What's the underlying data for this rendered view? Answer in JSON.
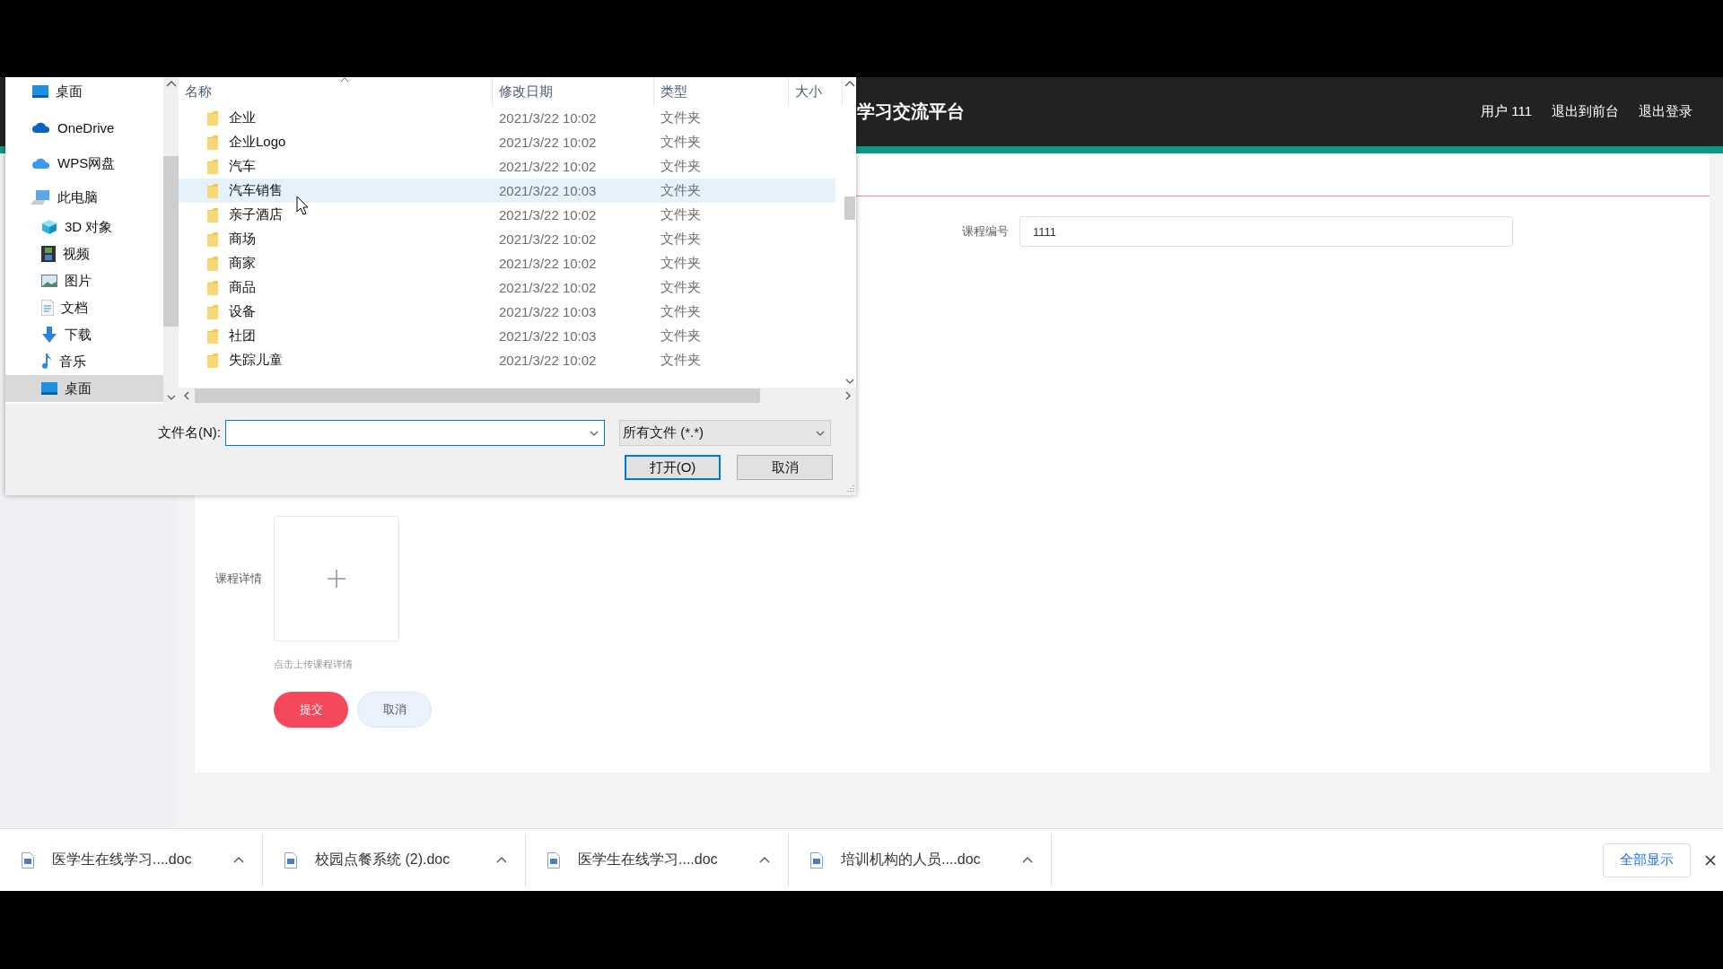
{
  "dialog": {
    "nav": [
      {
        "label": "桌面",
        "kind": "desktop",
        "selected": false
      },
      {
        "label": "OneDrive",
        "kind": "cloud",
        "selected": false
      },
      {
        "label": "WPS网盘",
        "kind": "cloud-light",
        "selected": false
      },
      {
        "label": "此电脑",
        "kind": "pc",
        "selected": false,
        "children": [
          {
            "label": "3D 对象",
            "kind": "cube",
            "selected": false
          },
          {
            "label": "视频",
            "kind": "film",
            "selected": false
          },
          {
            "label": "图片",
            "kind": "image",
            "selected": false
          },
          {
            "label": "文档",
            "kind": "document",
            "selected": false
          },
          {
            "label": "下载",
            "kind": "download",
            "selected": false
          },
          {
            "label": "音乐",
            "kind": "music",
            "selected": false
          },
          {
            "label": "桌面",
            "kind": "desktop",
            "selected": true
          }
        ]
      }
    ],
    "columns": [
      "名称",
      "修改日期",
      "类型",
      "大小"
    ],
    "rows": [
      {
        "name": "企业",
        "date": "2021/3/22 10:02",
        "type": "文件夹",
        "selected": false
      },
      {
        "name": "企业Logo",
        "date": "2021/3/22 10:02",
        "type": "文件夹",
        "selected": false
      },
      {
        "name": "汽车",
        "date": "2021/3/22 10:02",
        "type": "文件夹",
        "selected": false
      },
      {
        "name": "汽车销售",
        "date": "2021/3/22 10:03",
        "type": "文件夹",
        "selected": true
      },
      {
        "name": "亲子酒店",
        "date": "2021/3/22 10:02",
        "type": "文件夹",
        "selected": false
      },
      {
        "name": "商场",
        "date": "2021/3/22 10:02",
        "type": "文件夹",
        "selected": false
      },
      {
        "name": "商家",
        "date": "2021/3/22 10:02",
        "type": "文件夹",
        "selected": false
      },
      {
        "name": "商品",
        "date": "2021/3/22 10:02",
        "type": "文件夹",
        "selected": false
      },
      {
        "name": "设备",
        "date": "2021/3/22 10:03",
        "type": "文件夹",
        "selected": false
      },
      {
        "name": "社团",
        "date": "2021/3/22 10:03",
        "type": "文件夹",
        "selected": false
      },
      {
        "name": "失踪儿童",
        "date": "2021/3/22 10:02",
        "type": "文件夹",
        "selected": false
      }
    ],
    "filename_label": "文件名(N):",
    "filetype": "所有文件 (*.*)",
    "buttons": [
      {
        "label": "打开(O)",
        "default": true
      },
      {
        "label": "取消",
        "default": false
      }
    ]
  },
  "header": {
    "title": "学习交流平台",
    "links": [
      "用户 111",
      "退出到前台",
      "退出登录"
    ]
  },
  "form": {
    "fields": [
      {
        "label": "课程编号",
        "value": "1111"
      }
    ],
    "upload": {
      "label": "课程详情",
      "hint": "点击上传课程详情"
    },
    "buttons": [
      {
        "label": "提交",
        "kind": "primary"
      },
      {
        "label": "取消",
        "kind": "plain"
      }
    ]
  },
  "downloads": {
    "items": [
      "医学生在线学习....doc",
      "校园点餐系统 (2).doc",
      "医学生在线学习....doc",
      "培训机构的人员....doc"
    ],
    "show_all": "全部显示"
  }
}
